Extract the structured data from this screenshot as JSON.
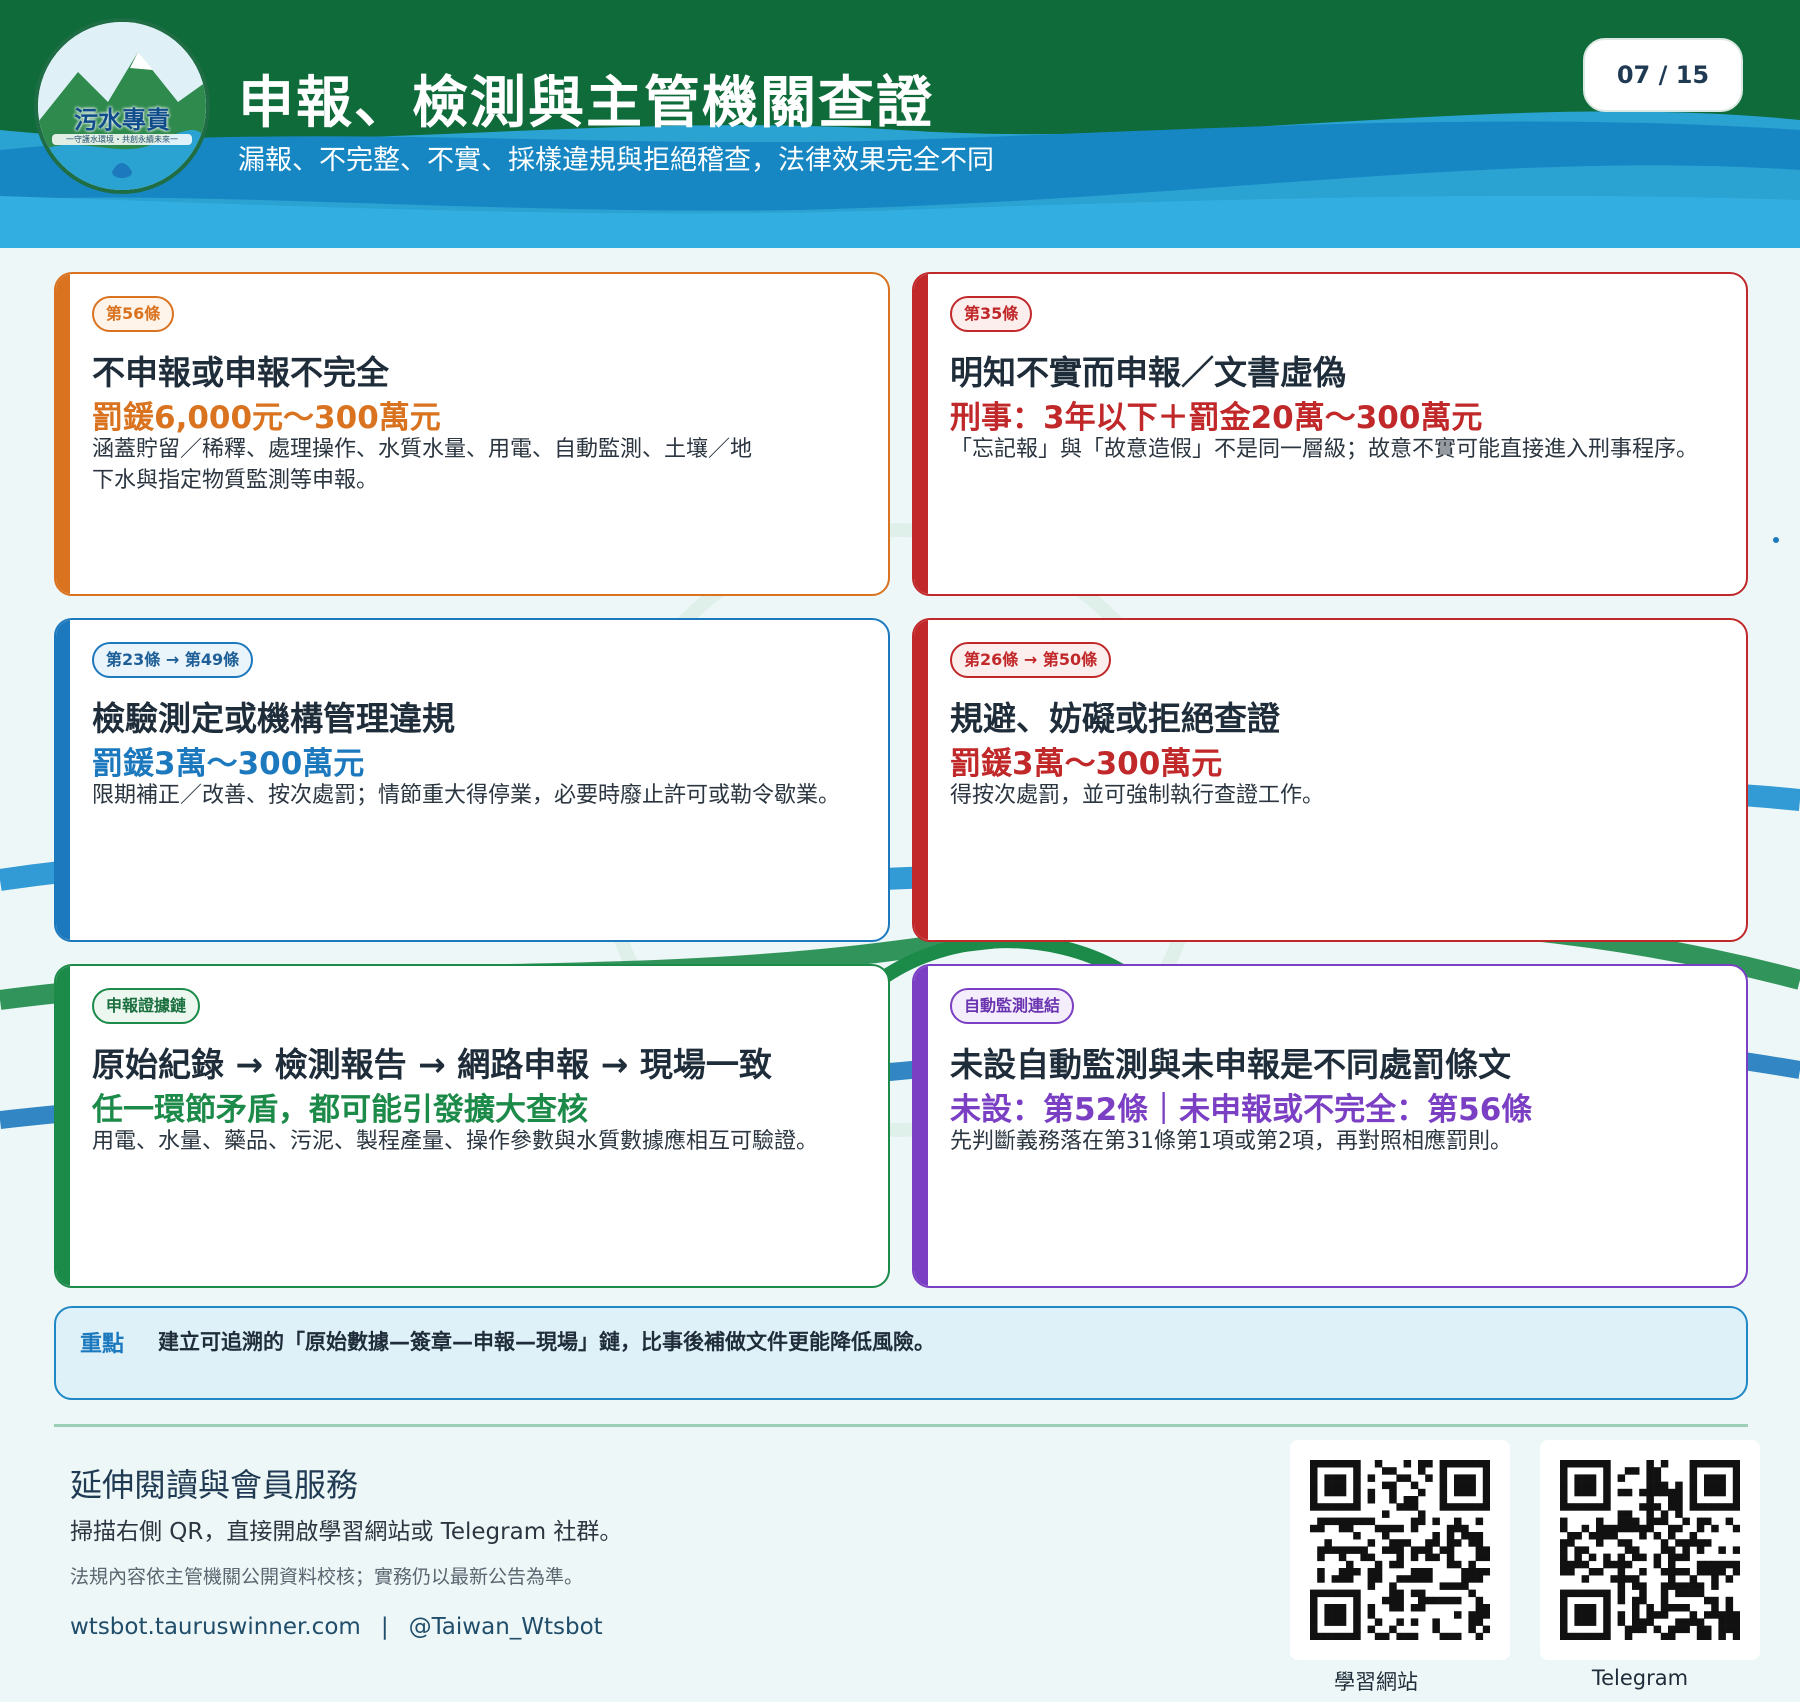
{
  "header": {
    "logo_text": "污水專責",
    "logo_sub": "一守護水環境・共創永續未來一",
    "title": "申報、檢測與主管機關查證",
    "subtitle": "漏報、不完整、不實、採樣違規與拒絕稽查，法律效果完全不同",
    "page_indicator": "07 / 15"
  },
  "cards": [
    {
      "tag": "第56條",
      "heading": "不申報或申報不完全",
      "highlight": "罰鍰6,000元～300萬元",
      "description": "涵蓋貯留／稀釋、處理操作、水質水量、用電、自動監測、土壤／地下水與指定物質監測等申報。",
      "accent": "#d9731f"
    },
    {
      "tag": "第35條",
      "heading": "明知不實而申報／文書虛偽",
      "highlight": "刑事：3年以下＋罰金20萬～300萬元",
      "description": "「忘記報」與「故意造假」不是同一層級；故意不實可能直接進入刑事程序。",
      "accent": "#c0282a"
    },
    {
      "tag": "第23條 → 第49條",
      "heading": "檢驗測定或機構管理違規",
      "highlight": "罰鍰3萬～300萬元",
      "description": "限期補正／改善、按次處罰；情節重大得停業，必要時廢止許可或勒令歇業。",
      "accent": "#1d79bd"
    },
    {
      "tag": "第26條 → 第50條",
      "heading": "規避、妨礙或拒絕查證",
      "highlight": "罰鍰3萬～300萬元",
      "description": "得按次處罰，並可強制執行查證工作。",
      "accent": "#c0282a"
    },
    {
      "tag": "申報證據鏈",
      "heading": "原始紀錄 → 檢測報告 → 網路申報 → 現場一致",
      "highlight": "任一環節矛盾，都可能引發擴大查核",
      "description": "用電、水量、藥品、污泥、製程產量、操作參數與水質數據應相互可驗證。",
      "accent": "#1c8a49"
    },
    {
      "tag": "自動監測連結",
      "heading": "未設自動監測與未申報是不同處罰條文",
      "highlight": "未設：第52條｜未申報或不完全：第56條",
      "description": "先判斷義務落在第31條第1項或第2項，再對照相應罰則。",
      "accent": "#7a3fc3"
    }
  ],
  "keypoint": {
    "label": "重點",
    "text": "建立可追溯的「原始數據—簽章—申報—現場」鏈，比事後補做文件更能降低風險。"
  },
  "footer": {
    "title": "延伸閱讀與會員服務",
    "line1": "掃描右側 QR，直接開啟學習網站或 Telegram 社群。",
    "line2": "法規內容依主管機關公開資料校核；實務仍以最新公告為準。",
    "website": "wtsbot.tauruswinner.com",
    "separator": "|",
    "telegram_handle": "@Taiwan_Wtsbot",
    "qr": [
      {
        "caption": "學習網站",
        "icon": "qr-code-icon"
      },
      {
        "caption": "Telegram",
        "icon": "qr-code-icon"
      }
    ]
  },
  "colors": {
    "header_green": "#0f6b3a",
    "header_blue": "#2aa3d3",
    "background": "#eef7f7"
  }
}
